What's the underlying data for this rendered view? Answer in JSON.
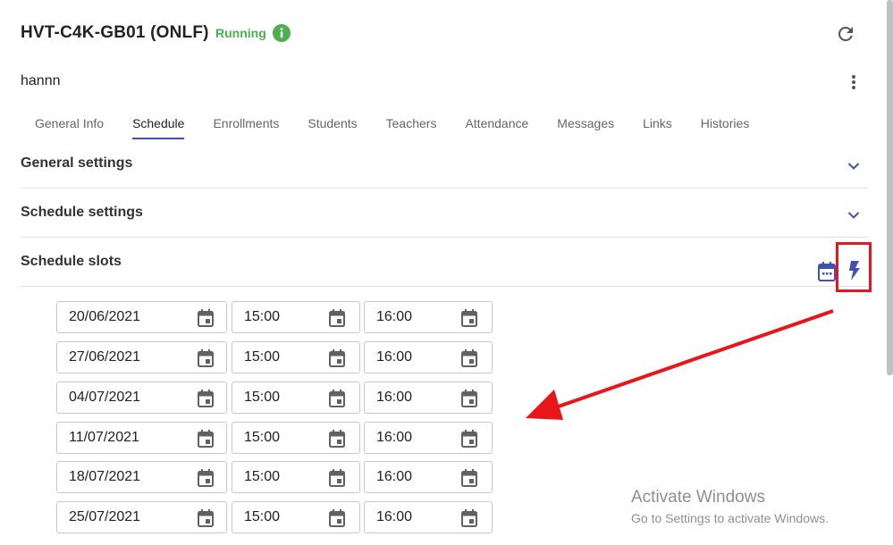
{
  "header": {
    "title": "HVT-C4K-GB01 (ONLF)",
    "status": "Running",
    "owner": "hannn"
  },
  "tabs": [
    {
      "label": "General Info",
      "active": false
    },
    {
      "label": "Schedule",
      "active": true
    },
    {
      "label": "Enrollments",
      "active": false
    },
    {
      "label": "Students",
      "active": false
    },
    {
      "label": "Teachers",
      "active": false
    },
    {
      "label": "Attendance",
      "active": false
    },
    {
      "label": "Messages",
      "active": false
    },
    {
      "label": "Links",
      "active": false
    },
    {
      "label": "Histories",
      "active": false
    }
  ],
  "sections": {
    "general_settings": "General settings",
    "schedule_settings": "Schedule settings",
    "schedule_slots": "Schedule slots"
  },
  "slots": [
    {
      "date": "20/06/2021",
      "start": "15:00",
      "end": "16:00"
    },
    {
      "date": "27/06/2021",
      "start": "15:00",
      "end": "16:00"
    },
    {
      "date": "04/07/2021",
      "start": "15:00",
      "end": "16:00"
    },
    {
      "date": "11/07/2021",
      "start": "15:00",
      "end": "16:00"
    },
    {
      "date": "18/07/2021",
      "start": "15:00",
      "end": "16:00"
    },
    {
      "date": "25/07/2021",
      "start": "15:00",
      "end": "16:00"
    }
  ],
  "watermark": {
    "line1": "Activate Windows",
    "line2": "Go to Settings to activate Windows."
  },
  "colors": {
    "accent": "#3f51b5",
    "status": "#4caf50",
    "annotation": "#e8161b"
  },
  "icons": [
    "info-icon",
    "refresh-icon",
    "more-vert-icon",
    "chevron-down-icon",
    "calendar-icon",
    "bolt-icon"
  ]
}
